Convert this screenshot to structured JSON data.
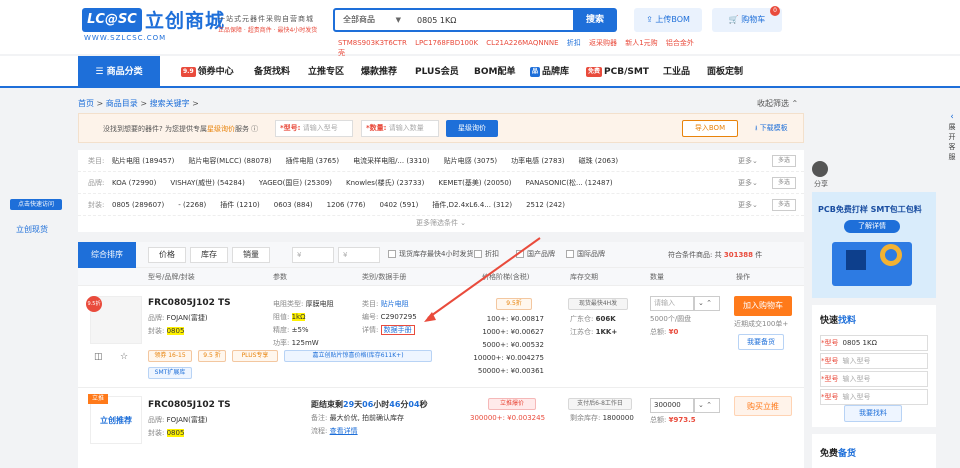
{
  "header": {
    "logo_badge": "LC@SC",
    "logo_name": "立创商城",
    "logo_url": "WWW.SZLCSC.COM",
    "slogan_main": "一站式元器件采购自营商城",
    "slogan_sub": "正品保障 · 超贵商件 · 最快4小时发货",
    "search_category": "全部商品",
    "search_value": "0805 1KΩ",
    "search_button": "搜索",
    "hot_words": [
      "STM8S903K3T6CTR",
      "LPC1768FBD100K",
      "CL21A226MAQNNNE",
      "折扣",
      "返采购器",
      "新人1元购",
      "铝合金外"
    ],
    "hot_words_wrap": "壳",
    "bom_button": "上传BOM",
    "cart_button": "购物车",
    "cart_count": "0"
  },
  "nav": {
    "category_button": "商品分类",
    "items": [
      {
        "tag": "9.9",
        "label": "领券中心"
      },
      {
        "tag": "",
        "label": "备货找料"
      },
      {
        "tag": "",
        "label": "立推专区"
      },
      {
        "tag": "",
        "label": "爆款推荐"
      },
      {
        "tag": "",
        "label": "PLUS会员"
      },
      {
        "tag": "",
        "label": "BOM配单"
      },
      {
        "tag": "品",
        "label": "品牌库"
      },
      {
        "tag": "免费",
        "label": "PCB/SMT"
      },
      {
        "tag": "",
        "label": "工业品"
      },
      {
        "tag": "",
        "label": "面板定制"
      }
    ]
  },
  "breadcrumb": {
    "home": "首页",
    "sep": ">",
    "catalog": "商品目录",
    "current": "搜索关键字",
    "collapse": "收起筛选"
  },
  "find_bar": {
    "text": "没找到想要的器件? 为您提供专属",
    "highlight": "星级询价",
    "text_end": "服务",
    "model_label": "*型号:",
    "model_placeholder": "请输入型号",
    "qty_label": "*数量:",
    "qty_placeholder": "请输入数量",
    "button": "星级询价",
    "import": "导入BOM",
    "download": "下载模板"
  },
  "filters": {
    "rows": [
      {
        "label": "类目:",
        "values": [
          "贴片电阻 (189457)",
          "贴片电容(MLCC) (88078)",
          "插件电阻 (3765)",
          "电流采样电阻/... (3310)",
          "贴片电感 (3075)",
          "功率电感 (2783)",
          "磁珠 (2063)"
        ]
      },
      {
        "label": "品牌:",
        "values": [
          "KOA (72990)",
          "VISHAY(威世) (54284)",
          "YAGEO(国巨) (25309)",
          "Knowles(楼氏) (23733)",
          "KEMET(基美) (20050)",
          "PANASONIC(松... (12487)"
        ]
      },
      {
        "label": "封装:",
        "values": [
          "0805 (289607)",
          "- (2268)",
          "插件 (1210)",
          "0603 (884)",
          "1206 (776)",
          "0402 (591)",
          "插件,D2.4xL6.4... (312)",
          "2512 (242)"
        ]
      }
    ],
    "more": "更多",
    "multi": "多选",
    "more_filters": "更多筛选条件"
  },
  "left_side": {
    "tag": "点击快速访问",
    "link": "立创现货"
  },
  "results": {
    "sort_tab": "综合排序",
    "sorts": [
      "价格",
      "库存",
      "销量"
    ],
    "range_from": "¥",
    "range_to": "¥",
    "checks": [
      "现货库存最快4小时发货",
      "折扣",
      "国产品牌",
      "国际品牌"
    ],
    "count_label": "符合条件商品: 共",
    "count_value": "301388",
    "count_unit": "件",
    "columns": [
      "型号/品牌/封装",
      "参数",
      "类别/数据手册",
      "价格阶梯(含税)",
      "库存交期",
      "数量",
      "操作"
    ]
  },
  "products": [
    {
      "name": "FRC0805J102 TS",
      "brand": "FOJAN(富捷)",
      "package": "0805",
      "params": [
        {
          "k": "电阻类型:",
          "v": "厚膜电阻"
        },
        {
          "k": "阻值:",
          "v": "1kΩ"
        },
        {
          "k": "精度:",
          "v": "±5%"
        },
        {
          "k": "功率:",
          "v": "125mW"
        }
      ],
      "category_label": "类目:",
      "category": "贴片电阻",
      "code_label": "编号:",
      "code": "C2907295",
      "detail_label": "详情:",
      "datasheet": "数据手册",
      "discount": "9.5折",
      "prices": [
        {
          "q": "100+:",
          "p": "¥0.00817"
        },
        {
          "q": "1000+:",
          "p": "¥0.00627"
        },
        {
          "q": "5000+:",
          "p": "¥0.00532"
        },
        {
          "q": "10000+:",
          "p": "¥0.004275"
        },
        {
          "q": "50000+:",
          "p": "¥0.00361"
        }
      ],
      "stock_badge": "现货最快4H发",
      "stock": [
        {
          "k": "广东仓:",
          "v": "606K"
        },
        {
          "k": "江苏仓:",
          "v": "1KK+"
        }
      ],
      "qty_placeholder": "请输入",
      "pkg_note": "5000个/圆盘",
      "total_label": "总额:",
      "total": "¥0",
      "add_cart": "加入购物车",
      "recent": "近期成交100单+",
      "want_stock": "我要备货",
      "tags": [
        "领券 16-15",
        "9.5 折",
        "PLUS专享",
        "嘉立创贴片惊喜价格(库存611K+)"
      ],
      "tag_extra": "SMT扩展库",
      "corner_badge": "9.5折"
    },
    {
      "name": "FRC0805J102 TS",
      "brand": "FOJAN(富捷)",
      "package": "0805",
      "corner_badge": "立推",
      "img_label": "立创推荐",
      "countdown_prefix": "距结束剩",
      "countdown": [
        "29",
        "天",
        "06",
        "小时",
        "46",
        "分",
        "04",
        "秒"
      ],
      "remark_label": "备注:",
      "remark": "最大价优, 拍前确认库存",
      "flow_label": "流程:",
      "flow": "查看详情",
      "promo_badge": "立推爆价",
      "promo_price": "300000+: ¥0.003245",
      "stock_badge": "支付后6-8工作日",
      "remaining_label": "剩余库存:",
      "remaining": "1800000",
      "qty": "300000",
      "total_label": "总额:",
      "total": "¥973.5",
      "buy": "购买立推"
    }
  ],
  "right_panel": {
    "share": "分享",
    "promo_title": "PCB免费打样  SMT包工包料",
    "promo_btn": "了解详情",
    "quick_title_a": "快速",
    "quick_title_b": "找料",
    "quick_fields": [
      {
        "label": "*型号",
        "value": "0805 1KΩ"
      },
      {
        "label": "*型号",
        "value": "输入型号"
      },
      {
        "label": "*型号",
        "value": "输入型号"
      },
      {
        "label": "*型号",
        "value": "输入型号"
      }
    ],
    "quick_btn": "我要找料",
    "free_a": "免费",
    "free_b": "备货"
  },
  "right_side": {
    "chars": [
      "展",
      "开",
      "客",
      "服"
    ]
  },
  "colors": {
    "brand": "#1e6fd9",
    "accent": "#ff7a1a",
    "danger": "#e94b3c",
    "highlight": "#fff200"
  }
}
